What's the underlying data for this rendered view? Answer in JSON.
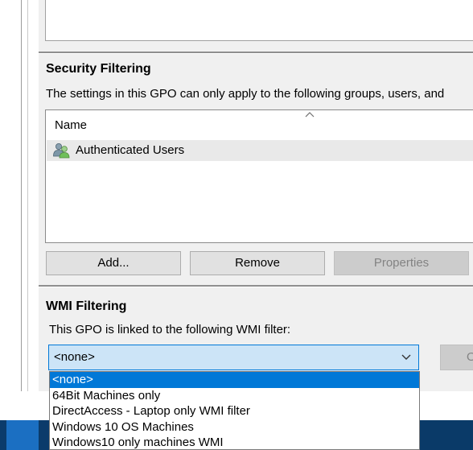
{
  "security_filtering": {
    "title": "Security Filtering",
    "description": "The settings in this GPO can only apply to the following groups, users, and",
    "column_header": "Name",
    "items": [
      {
        "label": "Authenticated Users",
        "icon": "users-icon"
      }
    ],
    "buttons": {
      "add": "Add...",
      "remove": "Remove",
      "properties": "Properties"
    }
  },
  "wmi_filtering": {
    "title": "WMI Filtering",
    "description": "This GPO is linked to the following WMI filter:",
    "selected_value": "<none>",
    "right_button_label": "O",
    "options": [
      "<none>",
      "64Bit Machines only",
      "DirectAccess - Laptop only WMI filter",
      "Windows 10 OS Machines",
      "Windows10 only machines WMI"
    ]
  },
  "colors": {
    "selection": "#0078d7",
    "combo_focus": "#cce4f7",
    "taskbar": "#0b3b6b"
  }
}
